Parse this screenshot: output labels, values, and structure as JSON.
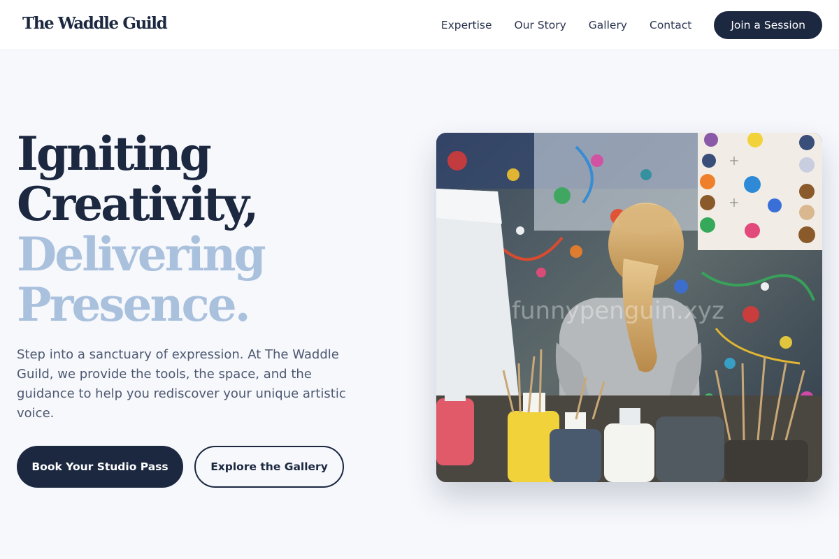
{
  "brand": {
    "name": "The Waddle Guild"
  },
  "nav": {
    "links": [
      "Expertise",
      "Our Story",
      "Gallery",
      "Contact"
    ],
    "cta": "Join a Session"
  },
  "hero": {
    "title_lines": [
      "Igniting",
      "Creativity,",
      "Delivering",
      "Presence."
    ],
    "description": "Step into a sanctuary of expression. At The Waddle Guild, we provide the tools, the space, and the guidance to help you rediscover your unique artistic voice.",
    "primary_button": "Book Your Studio Pass",
    "secondary_button": "Explore the Gallery",
    "image_alt": "Child with blonde ponytail facing a paint-splattered studio wall with jars of brushes and paint bottles",
    "image_watermark": "funnypenguin.xyz"
  },
  "colors": {
    "navy": "#1c2840",
    "accent_light_blue": "#aac1de",
    "background": "#f6f8fc",
    "body_text": "#4d5870"
  },
  "icons": []
}
